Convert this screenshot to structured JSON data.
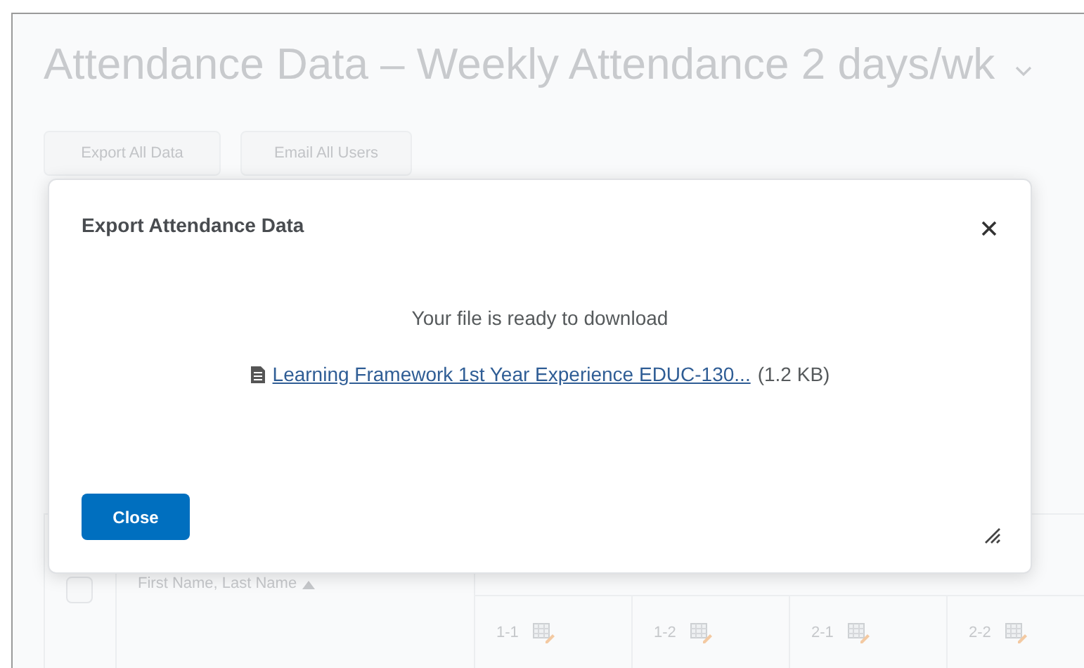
{
  "page": {
    "title": "Attendance Data – Weekly Attendance 2 days/wk",
    "buttons": [
      "Export All Data",
      "Email All Users"
    ],
    "table": {
      "select_all": {
        "checked": false
      },
      "name_column": "First Name, Last Name",
      "day_columns": [
        "1-1",
        "1-2",
        "2-1",
        "2-2"
      ]
    }
  },
  "dialog": {
    "title": "Export Attendance Data",
    "message": "Your file is ready to download",
    "file": {
      "name": "Learning Framework 1st Year Experience EDUC-130...",
      "size": "(1.2 KB)"
    },
    "buttons": [
      "Close"
    ]
  }
}
